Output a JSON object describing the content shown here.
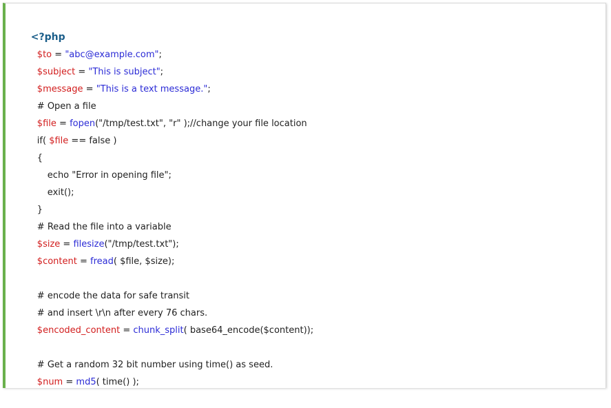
{
  "colors": {
    "accent_border": "#6ab04c",
    "php_tag": "#1b5e8a",
    "variable": "#d21d1d",
    "string": "#2b2bd6",
    "function": "#2b2bd6",
    "text": "#1f1f1f"
  },
  "code": {
    "open_tag": "<?php",
    "l1": {
      "dollar": "$",
      "var": "to",
      "op": " = ",
      "str": "\"abc@example.com\"",
      "end": ";"
    },
    "l2": {
      "dollar": "$",
      "var": "subject",
      "op": " = ",
      "str": "\"This is subject\"",
      "end": ";"
    },
    "l3": {
      "dollar": "$",
      "var": "message",
      "op": " = ",
      "str": "\"This is a text message.\"",
      "end": ";"
    },
    "l4": {
      "comment": "# Open a file"
    },
    "l5": {
      "dollar": "$",
      "var": "file",
      "op": " = ",
      "fn": "fopen",
      "rest": "(\"/tmp/test.txt\", \"r\" );//change your file location"
    },
    "l6": {
      "pre": "if( ",
      "dollar": "$",
      "var": "file",
      "rest": " == false )"
    },
    "l7": {
      "text": "{"
    },
    "l8": {
      "text": "echo \"Error in opening file\";"
    },
    "l9": {
      "text": "exit();"
    },
    "l10": {
      "text": "}"
    },
    "l11": {
      "comment": "# Read the file into a variable"
    },
    "l12": {
      "dollar": "$",
      "var": "size",
      "op": " = ",
      "fn": "filesize",
      "rest": "(\"/tmp/test.txt\");"
    },
    "l13": {
      "dollar": "$",
      "var": "content",
      "op": " = ",
      "fn": "fread",
      "rest": "( $file, $size);"
    },
    "l15": {
      "comment": "# encode the data for safe transit"
    },
    "l16": {
      "comment": "# and insert \\r\\n after every 76 chars."
    },
    "l17": {
      "dollar": "$",
      "var": "encoded_content",
      "op": " = ",
      "fn": "chunk_split",
      "rest": "( base64_encode($content));"
    },
    "l19": {
      "comment": "# Get a random 32 bit number using time() as seed."
    },
    "l20": {
      "dollar": "$",
      "var": "num",
      "op": " = ",
      "fn": "md5",
      "rest": "( time() );"
    }
  }
}
